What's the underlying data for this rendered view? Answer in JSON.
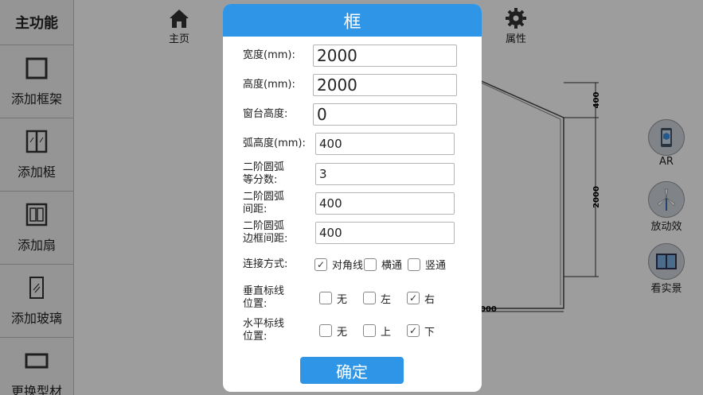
{
  "sidebar": {
    "title": "主功能",
    "items": [
      {
        "label": "添加框架",
        "icon": "frame-icon"
      },
      {
        "label": "添加梃",
        "icon": "mullion-icon"
      },
      {
        "label": "添加扇",
        "icon": "sash-icon"
      },
      {
        "label": "添加玻璃",
        "icon": "glass-icon"
      },
      {
        "label": "更换型材",
        "icon": "profile-icon"
      }
    ]
  },
  "topbar": {
    "home_label": "主页",
    "props_label": "属性"
  },
  "rightbar": {
    "ar_label": "AR",
    "anim_label": "放动效",
    "real_label": "看实景"
  },
  "drawing": {
    "dim_top": "400",
    "dim_right": "2000",
    "dim_bottom": "000"
  },
  "dialog": {
    "title": "框",
    "width_label": "宽度(mm):",
    "width_value": "2000",
    "height_label": "高度(mm):",
    "height_value": "2000",
    "sill_label": "窗台高度:",
    "sill_value": "0",
    "arc_label": "弧高度(mm):",
    "arc_value": "400",
    "div_label_1": "二阶圆弧",
    "div_label_2": "等分数:",
    "div_value": "3",
    "gap_label_1": "二阶圆弧",
    "gap_label_2": "间距:",
    "gap_value": "400",
    "edge_label_1": "二阶圆弧",
    "edge_label_2": "边框间距:",
    "edge_value": "400",
    "connect_label": "连接方式:",
    "connect_options": [
      {
        "label": "对角线",
        "checked": true
      },
      {
        "label": "横通",
        "checked": false
      },
      {
        "label": "竖通",
        "checked": false
      }
    ],
    "vline_label_1": "垂直标线",
    "vline_label_2": "位置:",
    "vline_options": [
      {
        "label": "无",
        "checked": false
      },
      {
        "label": "左",
        "checked": false
      },
      {
        "label": "右",
        "checked": true
      }
    ],
    "hline_label_1": "水平标线",
    "hline_label_2": "位置:",
    "hline_options": [
      {
        "label": "无",
        "checked": false
      },
      {
        "label": "上",
        "checked": false
      },
      {
        "label": "下",
        "checked": true
      }
    ],
    "ok_label": "确定"
  },
  "colors": {
    "accent": "#2f95e6"
  }
}
